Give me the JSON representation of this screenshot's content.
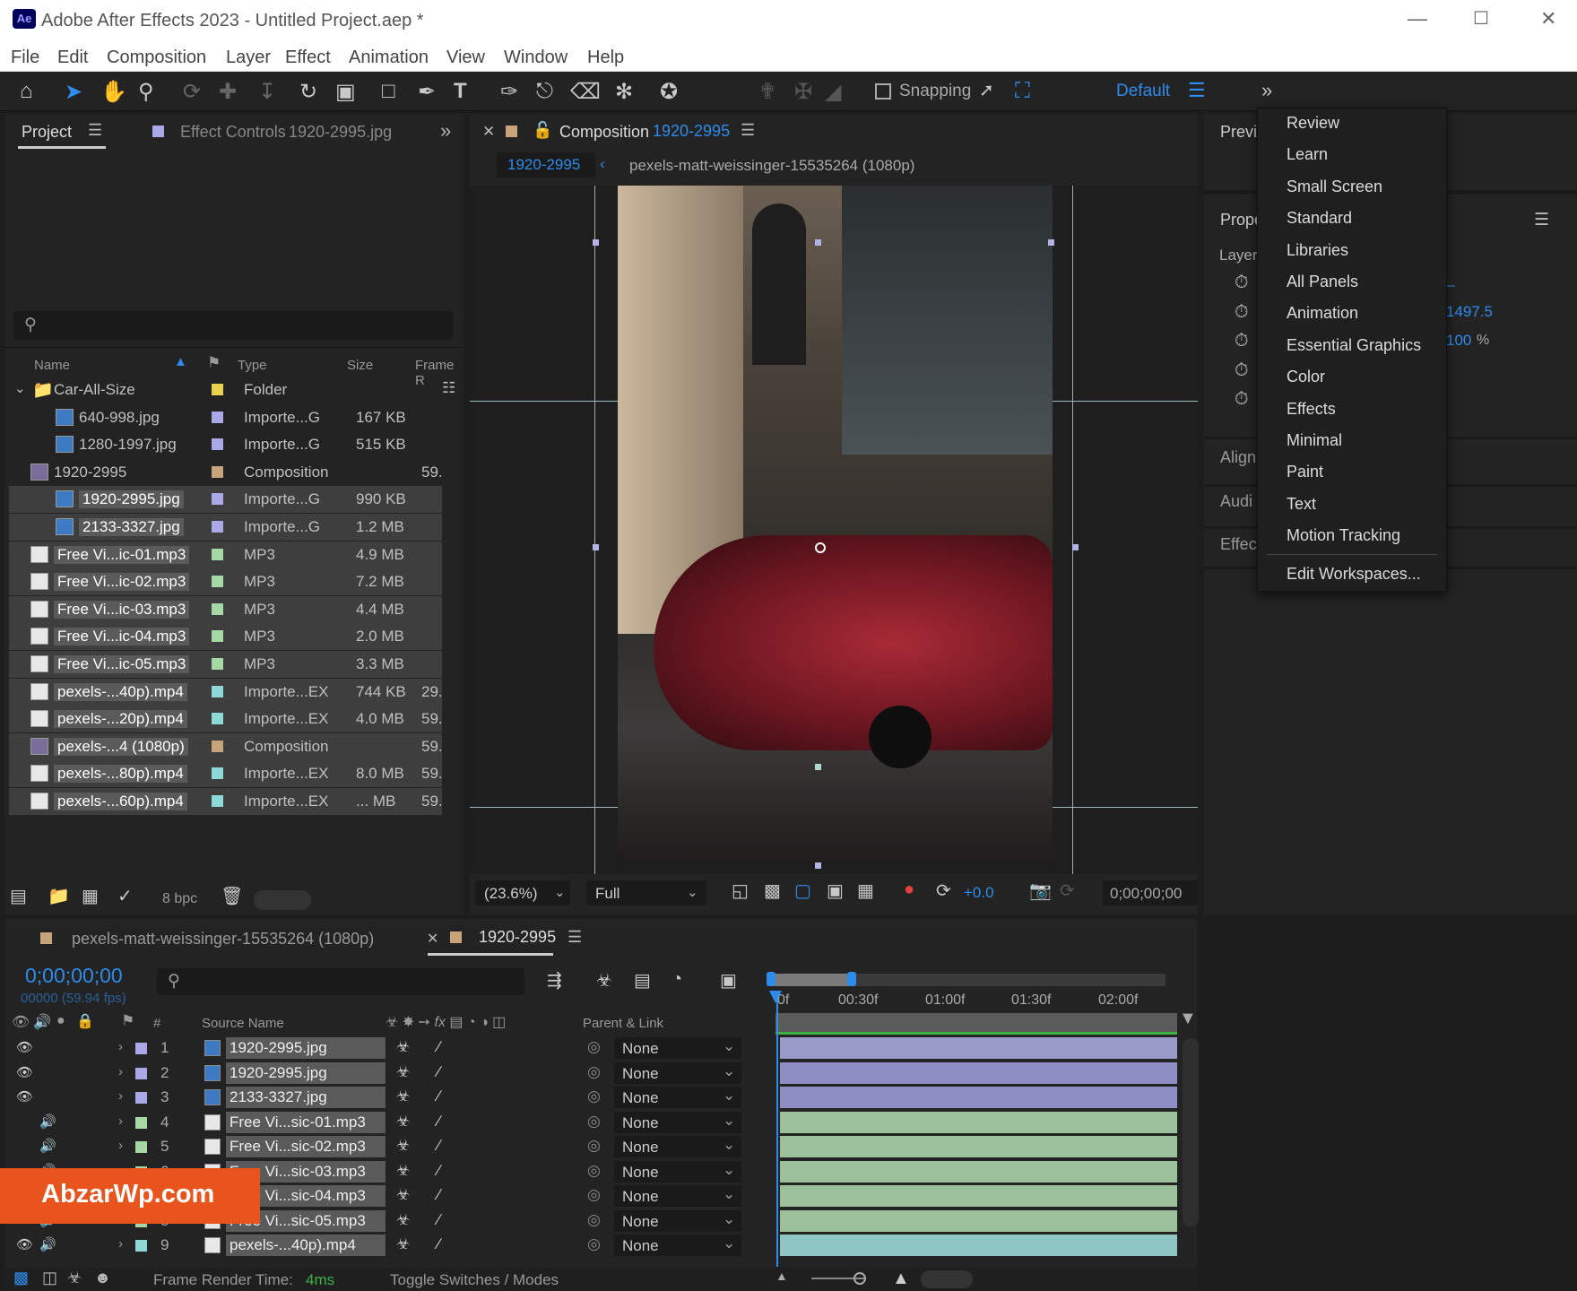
{
  "window": {
    "title": "Adobe After Effects 2023 - Untitled Project.aep *",
    "app_icon": "Ae"
  },
  "menu": [
    "File",
    "Edit",
    "Composition",
    "Layer",
    "Effect",
    "Animation",
    "View",
    "Window",
    "Help"
  ],
  "toolbar": {
    "snapping": "Snapping",
    "workspace": "Default"
  },
  "project_panel": {
    "tab_project": "Project",
    "tab_effect_controls": "Effect Controls",
    "effect_controls_file": "1920-2995.jpg",
    "columns": {
      "name": "Name",
      "type": "Type",
      "size": "Size",
      "frame_rate": "Frame R"
    },
    "rows": [
      {
        "name": "Car-All-Size",
        "type": "Folder",
        "size": "",
        "fr": "",
        "color": "#e8d14c",
        "kind": "folder",
        "sel": false
      },
      {
        "name": "640-998.jpg",
        "type": "Importe...G",
        "size": "167 KB",
        "fr": "",
        "color": "#a9a9e8",
        "kind": "img",
        "sel": false
      },
      {
        "name": "1280-1997.jpg",
        "type": "Importe...G",
        "size": "515 KB",
        "fr": "",
        "color": "#a9a9e8",
        "kind": "img",
        "sel": false
      },
      {
        "name": "1920-2995",
        "type": "Composition",
        "size": "",
        "fr": "59.",
        "color": "#c8a47a",
        "kind": "comp",
        "sel": false
      },
      {
        "name": "1920-2995.jpg",
        "type": "Importe...G",
        "size": "990 KB",
        "fr": "",
        "color": "#a9a9e8",
        "kind": "img",
        "sel": true
      },
      {
        "name": "2133-3327.jpg",
        "type": "Importe...G",
        "size": "1.2 MB",
        "fr": "",
        "color": "#a9a9e8",
        "kind": "img",
        "sel": true
      },
      {
        "name": "Free Vi...ic-01.mp3",
        "type": "MP3",
        "size": "4.9 MB",
        "fr": "",
        "color": "#a6d8a6",
        "kind": "audio",
        "sel": true
      },
      {
        "name": "Free Vi...ic-02.mp3",
        "type": "MP3",
        "size": "7.2 MB",
        "fr": "",
        "color": "#a6d8a6",
        "kind": "audio",
        "sel": true
      },
      {
        "name": "Free Vi...ic-03.mp3",
        "type": "MP3",
        "size": "4.4 MB",
        "fr": "",
        "color": "#a6d8a6",
        "kind": "audio",
        "sel": true
      },
      {
        "name": "Free Vi...ic-04.mp3",
        "type": "MP3",
        "size": "2.0 MB",
        "fr": "",
        "color": "#a6d8a6",
        "kind": "audio",
        "sel": true
      },
      {
        "name": "Free Vi...ic-05.mp3",
        "type": "MP3",
        "size": "3.3 MB",
        "fr": "",
        "color": "#a6d8a6",
        "kind": "audio",
        "sel": true
      },
      {
        "name": "pexels-...40p).mp4",
        "type": "Importe...EX",
        "size": "744 KB",
        "fr": "29.",
        "color": "#8fd8d8",
        "kind": "video",
        "sel": true
      },
      {
        "name": "pexels-...20p).mp4",
        "type": "Importe...EX",
        "size": "4.0 MB",
        "fr": "59.",
        "color": "#8fd8d8",
        "kind": "video",
        "sel": true
      },
      {
        "name": "pexels-...4 (1080p)",
        "type": "Composition",
        "size": "",
        "fr": "59.",
        "color": "#c8a47a",
        "kind": "comp",
        "sel": true
      },
      {
        "name": "pexels-...80p).mp4",
        "type": "Importe...EX",
        "size": "8.0 MB",
        "fr": "59.",
        "color": "#8fd8d8",
        "kind": "video",
        "sel": true
      },
      {
        "name": "pexels-...60p).mp4",
        "type": "Importe...EX",
        "size": "... MB",
        "fr": "59.",
        "color": "#8fd8d8",
        "kind": "video",
        "sel": true
      }
    ],
    "bpc": "8 bpc"
  },
  "comp_panel": {
    "tab_label": "Composition",
    "comp_name": "1920-2995",
    "breadcrumb_active": "1920-2995",
    "breadcrumb_next": "pexels-matt-weissinger-15535264 (1080p)",
    "zoom": "(23.6%)",
    "resolution": "Full",
    "exposure": "+0.0",
    "timecode": "0;00;00;00"
  },
  "right_panel": {
    "preview": "Previ",
    "properties": "Prope",
    "layer": "Layer",
    "align": "Align",
    "audio": "Audi",
    "effects": "Effec",
    "val1": "1497.5",
    "val2": "100",
    "val3": "%",
    "val4": "_"
  },
  "workspace_menu": [
    "Review",
    "Learn",
    "Small Screen",
    "Standard",
    "Libraries",
    "All Panels",
    "Animation",
    "Essential Graphics",
    "Color",
    "Effects",
    "Minimal",
    "Paint",
    "Text",
    "Motion Tracking",
    "Edit Workspaces..."
  ],
  "timeline": {
    "tab1": "pexels-matt-weissinger-15535264 (1080p)",
    "tab2": "1920-2995",
    "timecode": "0;00;00;00",
    "fps": "00000 (59.94 fps)",
    "col_source": "Source Name",
    "col_parent": "Parent & Link",
    "col_num": "#",
    "ruler": [
      "0f",
      "00:30f",
      "01:00f",
      "01:30f",
      "02:00f"
    ],
    "layers": [
      {
        "num": "1",
        "name": "1920-2995.jpg",
        "parent": "None",
        "color": "#a9a9e8",
        "kind": "img",
        "eye": true,
        "bar": "#9a9ac8"
      },
      {
        "num": "2",
        "name": "1920-2995.jpg",
        "parent": "None",
        "color": "#a9a9e8",
        "kind": "img",
        "eye": true,
        "bar": "#8e8ec4"
      },
      {
        "num": "3",
        "name": "2133-3327.jpg",
        "parent": "None",
        "color": "#a9a9e8",
        "kind": "img",
        "eye": true,
        "bar": "#8e8ec4"
      },
      {
        "num": "4",
        "name": "Free Vi...sic-01.mp3",
        "parent": "None",
        "color": "#a6d8a6",
        "kind": "audio",
        "eye": false,
        "bar": "#9cc09c"
      },
      {
        "num": "5",
        "name": "Free Vi...sic-02.mp3",
        "parent": "None",
        "color": "#a6d8a6",
        "kind": "audio",
        "eye": false,
        "bar": "#9cc09c"
      },
      {
        "num": "6",
        "name": "Free Vi...sic-03.mp3",
        "parent": "None",
        "color": "#a6d8a6",
        "kind": "audio",
        "eye": false,
        "bar": "#9cc09c"
      },
      {
        "num": "7",
        "name": "Free Vi...sic-04.mp3",
        "parent": "None",
        "color": "#a6d8a6",
        "kind": "audio",
        "eye": false,
        "bar": "#9cc09c"
      },
      {
        "num": "8",
        "name": "Free Vi...sic-05.mp3",
        "parent": "None",
        "color": "#a6d8a6",
        "kind": "audio",
        "eye": false,
        "bar": "#9cc09c"
      },
      {
        "num": "9",
        "name": "pexels-...40p).mp4",
        "parent": "None",
        "color": "#8fd8d8",
        "kind": "video",
        "eye": true,
        "bar": "#8ec4c4"
      }
    ],
    "render_label": "Frame Render Time:",
    "render_value": "4ms",
    "toggle": "Toggle Switches / Modes"
  },
  "watermark": "AbzarWp.com",
  "colors": {
    "accent": "#2d8ceb",
    "playhead": "#2d8ceb",
    "green": "#3cb043",
    "watermark_bg": "#e8541c"
  }
}
